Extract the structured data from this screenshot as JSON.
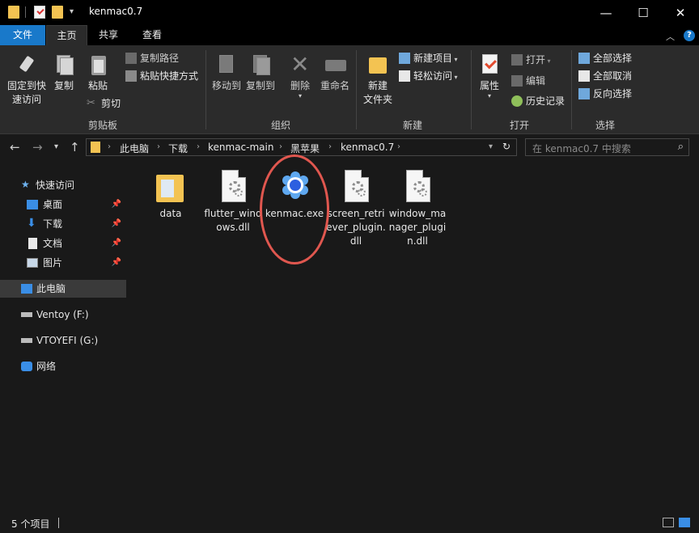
{
  "window": {
    "title": "kenmac0.7",
    "minimize": "—",
    "maximize": "☐",
    "close": "✕"
  },
  "tabs": {
    "file": "文件",
    "home": "主页",
    "share": "共享",
    "view": "查看"
  },
  "ribbon": {
    "clipboard": {
      "label": "剪贴板",
      "pin": "固定到快\n速访问",
      "pin_line1": "固定到快",
      "pin_line2": "速访问",
      "copy": "复制",
      "paste": "粘贴",
      "copy_path": "复制路径",
      "paste_shortcut": "粘贴快捷方式",
      "cut": "剪切"
    },
    "organize": {
      "label": "组织",
      "move_to": "移动到",
      "copy_to": "复制到",
      "delete": "删除",
      "rename": "重命名"
    },
    "new": {
      "label": "新建",
      "new_folder_line1": "新建",
      "new_folder_line2": "文件夹",
      "new_item": "新建项目",
      "easy_access": "轻松访问"
    },
    "open": {
      "label": "打开",
      "properties": "属性",
      "open": "打开",
      "edit": "编辑",
      "history": "历史记录"
    },
    "select": {
      "label": "选择",
      "select_all": "全部选择",
      "select_none": "全部取消",
      "invert": "反向选择"
    }
  },
  "address": {
    "crumbs": [
      "此电脑",
      "下载",
      "kenmac-main",
      "黑苹果",
      "kenmac0.7"
    ],
    "search_placeholder": "在 kenmac0.7 中搜索"
  },
  "nav": {
    "quick_access": "快速访问",
    "desktop": "桌面",
    "downloads": "下载",
    "documents": "文档",
    "pictures": "图片",
    "this_pc": "此电脑",
    "ventoy": "Ventoy (F:)",
    "vtoyefi": "VTOYEFI (G:)",
    "network": "网络"
  },
  "files": [
    {
      "name": "data",
      "type": "folder"
    },
    {
      "name": "flutter_windows.dll",
      "type": "dll"
    },
    {
      "name": "kenmac.exe",
      "type": "exe"
    },
    {
      "name": "screen_retriever_plugin.dll",
      "type": "dll"
    },
    {
      "name": "window_manager_plugin.dll",
      "type": "dll"
    }
  ],
  "status": {
    "item_count": "5 个项目"
  },
  "colors": {
    "accent": "#1979ca",
    "annotation": "#e0574f",
    "folder": "#f3c352"
  }
}
